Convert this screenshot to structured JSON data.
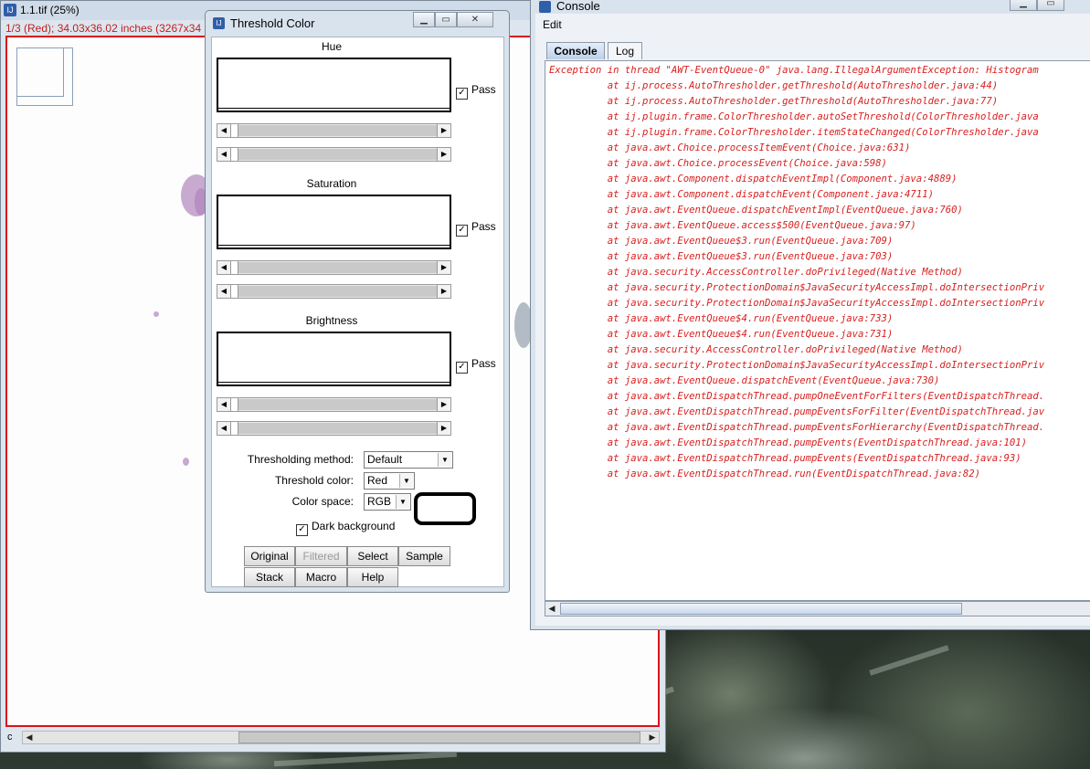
{
  "image_window": {
    "title": "1.1.tif (25%)",
    "info": "1/3 (Red); 34.03x36.02 inches (3267x34",
    "scroll_label": "c"
  },
  "threshold": {
    "title": "Threshold Color",
    "sections": [
      {
        "label": "Hue",
        "pass_label": "Pass",
        "pass_checked": true
      },
      {
        "label": "Saturation",
        "pass_label": "Pass",
        "pass_checked": true
      },
      {
        "label": "Brightness",
        "pass_label": "Pass",
        "pass_checked": true
      }
    ],
    "method_label": "Thresholding method:",
    "method_value": "Default",
    "color_label": "Threshold color:",
    "color_value": "Red",
    "space_label": "Color space:",
    "space_value": "RGB",
    "dark_bg_label": "Dark background",
    "dark_bg_checked": true,
    "buttons": {
      "original": "Original",
      "filtered": "Filtered",
      "select": "Select",
      "sample": "Sample",
      "stack": "Stack",
      "macro": "Macro",
      "help": "Help"
    }
  },
  "console": {
    "title": "Console",
    "menu": {
      "edit": "Edit"
    },
    "tabs": {
      "console": "Console",
      "log": "Log"
    },
    "lines": [
      "Exception in thread \"AWT-EventQueue-0\" java.lang.IllegalArgumentException: Histogram",
      "          at ij.process.AutoThresholder.getThreshold(AutoThresholder.java:44)",
      "          at ij.process.AutoThresholder.getThreshold(AutoThresholder.java:77)",
      "          at ij.plugin.frame.ColorThresholder.autoSetThreshold(ColorThresholder.java",
      "          at ij.plugin.frame.ColorThresholder.itemStateChanged(ColorThresholder.java",
      "          at java.awt.Choice.processItemEvent(Choice.java:631)",
      "          at java.awt.Choice.processEvent(Choice.java:598)",
      "          at java.awt.Component.dispatchEventImpl(Component.java:4889)",
      "          at java.awt.Component.dispatchEvent(Component.java:4711)",
      "          at java.awt.EventQueue.dispatchEventImpl(EventQueue.java:760)",
      "          at java.awt.EventQueue.access$500(EventQueue.java:97)",
      "          at java.awt.EventQueue$3.run(EventQueue.java:709)",
      "          at java.awt.EventQueue$3.run(EventQueue.java:703)",
      "          at java.security.AccessController.doPrivileged(Native Method)",
      "          at java.security.ProtectionDomain$JavaSecurityAccessImpl.doIntersectionPriv",
      "          at java.security.ProtectionDomain$JavaSecurityAccessImpl.doIntersectionPriv",
      "          at java.awt.EventQueue$4.run(EventQueue.java:733)",
      "          at java.awt.EventQueue$4.run(EventQueue.java:731)",
      "          at java.security.AccessController.doPrivileged(Native Method)",
      "          at java.security.ProtectionDomain$JavaSecurityAccessImpl.doIntersectionPriv",
      "          at java.awt.EventQueue.dispatchEvent(EventQueue.java:730)",
      "          at java.awt.EventDispatchThread.pumpOneEventForFilters(EventDispatchThread.",
      "          at java.awt.EventDispatchThread.pumpEventsForFilter(EventDispatchThread.jav",
      "          at java.awt.EventDispatchThread.pumpEventsForHierarchy(EventDispatchThread.",
      "          at java.awt.EventDispatchThread.pumpEvents(EventDispatchThread.java:101)",
      "          at java.awt.EventDispatchThread.pumpEvents(EventDispatchThread.java:93)",
      "          at java.awt.EventDispatchThread.run(EventDispatchThread.java:82)"
    ]
  }
}
